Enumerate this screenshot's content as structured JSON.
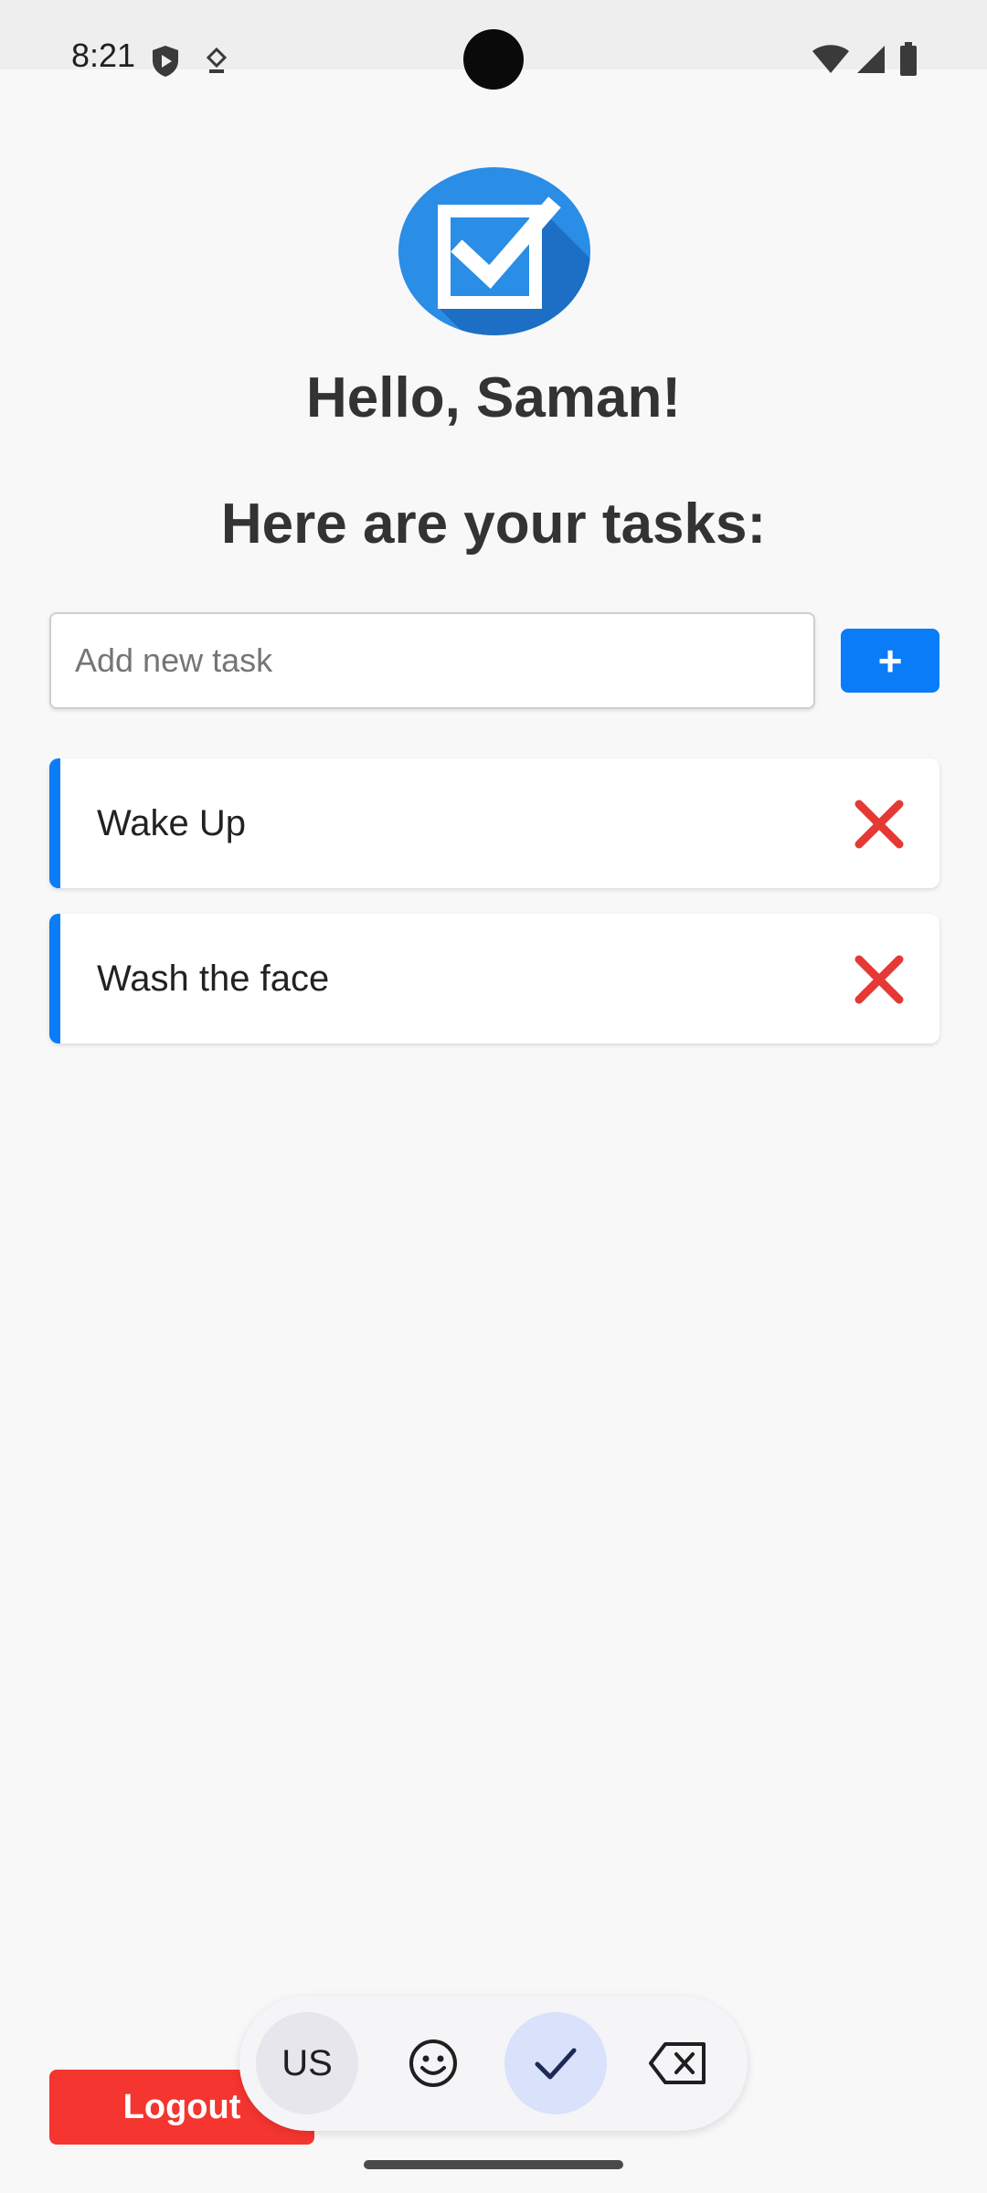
{
  "status_bar": {
    "time": "8:21",
    "icons": [
      "shield-play-icon",
      "download-indicator-icon",
      "wifi-icon",
      "cell-signal-icon",
      "battery-icon"
    ]
  },
  "app": {
    "logo_icon": "checkbox-checked-icon",
    "greeting": "Hello, Saman!",
    "subtitle": "Here are your tasks:",
    "input": {
      "placeholder": "Add new task",
      "value": ""
    },
    "add_button_label": "+",
    "tasks": [
      {
        "text": "Wake Up",
        "delete_icon": "red-x-icon"
      },
      {
        "text": "Wash the face",
        "delete_icon": "red-x-icon"
      }
    ],
    "logout_label": "Logout"
  },
  "keyboard_toolbar": {
    "language_label": "US",
    "buttons": [
      "emoji-icon",
      "checkmark-icon",
      "backspace-icon"
    ]
  },
  "colors": {
    "accent": "#0a7cf7",
    "logout": "#f5352f",
    "delete": "#e53935",
    "background": "#f8f8f9"
  }
}
